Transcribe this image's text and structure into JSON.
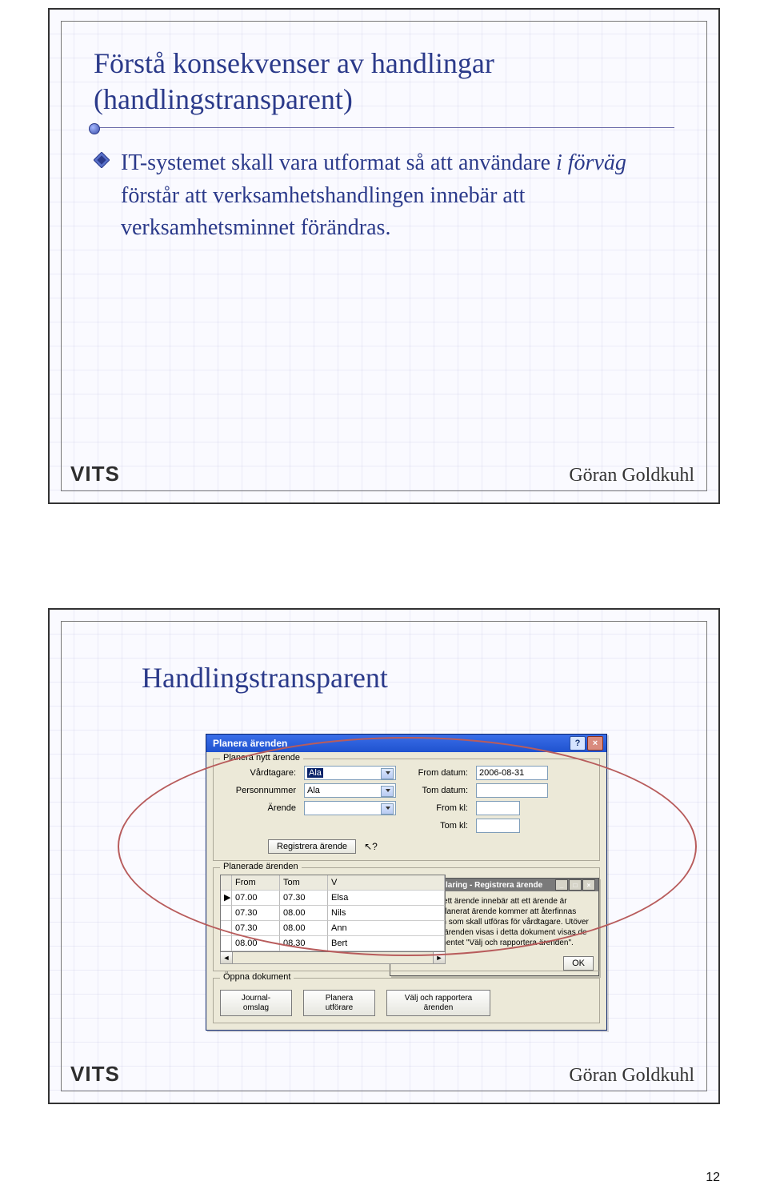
{
  "slide1": {
    "title": "Förstå konsekvenser av handlingar (handlingstransparent)",
    "bullet": {
      "pre": "IT-systemet skall vara utformat så att användare ",
      "em": "i förväg",
      "post": " förstår att verksamhetshandlingen innebär att verksamhetsminnet förändras."
    },
    "footer_left": "VITS",
    "footer_right": "Göran Goldkuhl"
  },
  "slide2": {
    "title": "Handlingstransparent",
    "footer_left": "VITS",
    "footer_right": "Göran Goldkuhl",
    "window": {
      "title": "Planera ärenden",
      "help": "?",
      "close": "×",
      "fieldset1_legend": "Planera nytt ärende",
      "labels": {
        "vardtagare": "Vårdtagare:",
        "personnummer": "Personnummer",
        "arende": "Ärende",
        "from_datum": "From datum:",
        "tom_datum": "Tom datum:",
        "from_kl": "From kl:",
        "tom_kl": "Tom kl:"
      },
      "values": {
        "vardtagare": "Ala",
        "personnummer": "Ala",
        "arende": "",
        "from_datum": "2006-08-31",
        "tom_datum": "",
        "from_kl": "",
        "tom_kl": ""
      },
      "register_btn": "Registrera ärende",
      "cursor_hint": "?",
      "fieldset2_legend": "Planerade ärenden",
      "table": {
        "headers": [
          "",
          "From",
          "Tom",
          "V"
        ],
        "rows": [
          [
            "▶",
            "07.00",
            "07.30",
            "Elsa"
          ],
          [
            "",
            "07.30",
            "08.00",
            "Nils"
          ],
          [
            "",
            "07.30",
            "08.00",
            "Ann"
          ],
          [
            "",
            "08.00",
            "08.30",
            "Bert"
          ]
        ]
      },
      "fieldset3_legend": "Öppna dokument",
      "doc1_line1": "Journal-",
      "doc1_line2": "omslag",
      "doc2_line1": "Planera",
      "doc2_line2": "utförare",
      "doc3_line1": "Välj och rapportera",
      "doc3_line2": "ärenden"
    },
    "popup": {
      "title": "Begreppsförklaring - Registrera ärende",
      "body": "Att registrera ett ärende innebär att ett ärende är planerat. Ett planerat ärende kommer att återfinnas bland ärenden som skall utföras för vårdtagare. Utöver att planerade ärenden visas i detta dokument visas de också i dokumentet \"Välj och rapportera ärenden\".",
      "ok": "OK",
      "min": "_",
      "max": "□",
      "close": "×"
    }
  },
  "page_number": "12"
}
